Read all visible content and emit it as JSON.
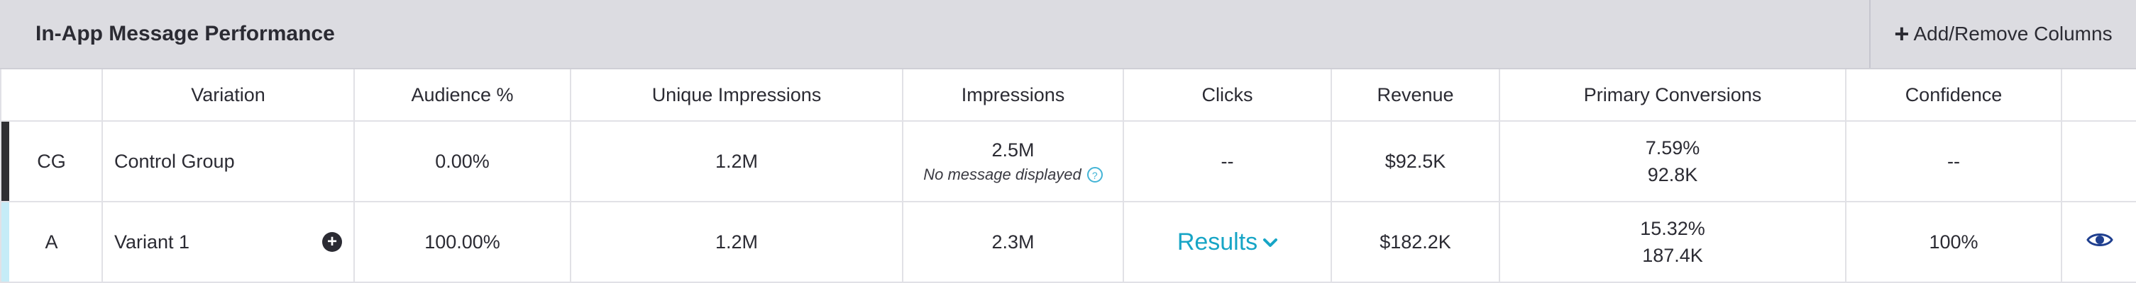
{
  "header": {
    "title": "In-App Message Performance",
    "add_remove_columns": "Add/Remove Columns",
    "add_icon": "plus-icon"
  },
  "columns": [
    "",
    "Variation",
    "Audience %",
    "Unique Impressions",
    "Impressions",
    "Clicks",
    "Revenue",
    "Primary Conversions",
    "Confidence",
    ""
  ],
  "rows": [
    {
      "code": "CG",
      "accent_color": "#2f2f33",
      "variation": "Control Group",
      "audience": "0.00%",
      "unique_impressions": "1.2M",
      "impressions": "2.5M",
      "impressions_note": "No message displayed",
      "clicks": "--",
      "revenue": "$92.5K",
      "conversion_rate": "7.59%",
      "conversions": "92.8K",
      "confidence": "--"
    },
    {
      "code": "A",
      "accent_color": "#c5ecf7",
      "variation": "Variant 1",
      "audience": "100.00%",
      "unique_impressions": "1.2M",
      "impressions": "2.3M",
      "clicks": "Results",
      "revenue": "$182.2K",
      "conversion_rate": "15.32%",
      "conversions": "187.4K",
      "confidence": "100%",
      "confidence_color": "#39c392",
      "action_icon": "eye-icon"
    }
  ],
  "colors": {
    "header_bg": "#dcdce1",
    "link": "#17a5c6",
    "eye": "#1f3f8f"
  }
}
